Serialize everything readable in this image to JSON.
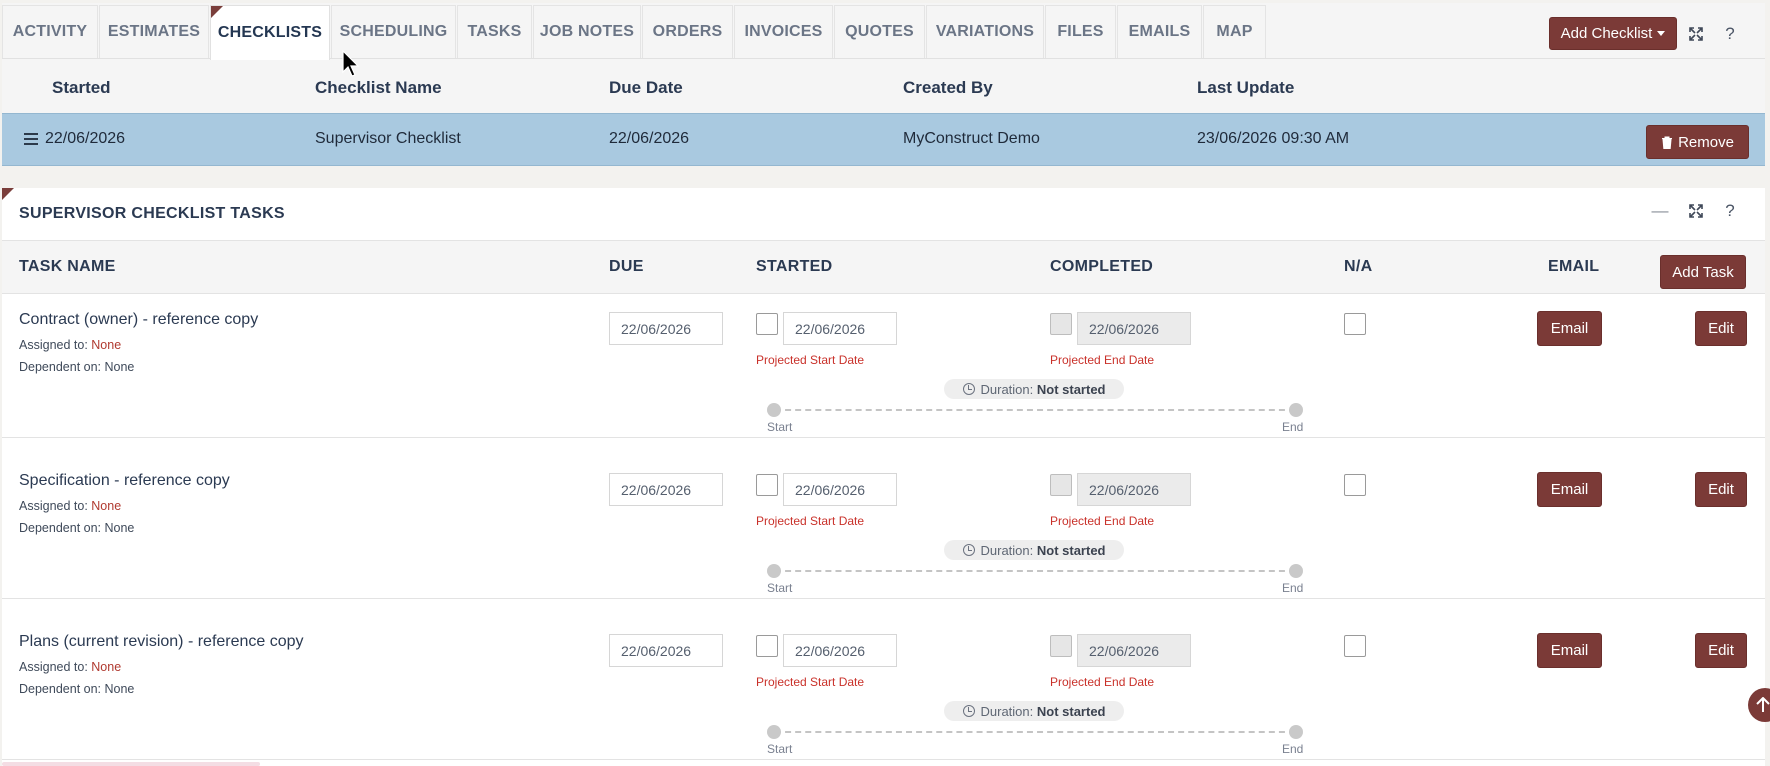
{
  "tabs": [
    {
      "label": "ACTIVITY",
      "active": false
    },
    {
      "label": "ESTIMATES",
      "active": false
    },
    {
      "label": "CHECKLISTS",
      "active": true
    },
    {
      "label": "SCHEDULING",
      "active": false
    },
    {
      "label": "TASKS",
      "active": false
    },
    {
      "label": "JOB NOTES",
      "active": false
    },
    {
      "label": "ORDERS",
      "active": false
    },
    {
      "label": "INVOICES",
      "active": false
    },
    {
      "label": "QUOTES",
      "active": false
    },
    {
      "label": "VARIATIONS",
      "active": false
    },
    {
      "label": "FILES",
      "active": false
    },
    {
      "label": "EMAILS",
      "active": false
    },
    {
      "label": "MAP",
      "active": false
    }
  ],
  "toolbar": {
    "add_checklist_label": "Add Checklist",
    "expand_icon": "expand-icon",
    "help_label": "?"
  },
  "checklists_table": {
    "headers": [
      "Started",
      "Checklist Name",
      "Due Date",
      "Created By",
      "Last Update"
    ],
    "rows": [
      {
        "started": "22/06/2026",
        "name": "Supervisor Checklist",
        "due": "22/06/2026",
        "created_by": "MyConstruct Demo",
        "last_update": "23/06/2026 09:30 AM",
        "remove_label": "Remove"
      }
    ]
  },
  "tasks_panel": {
    "title": "SUPERVISOR CHECKLIST TASKS",
    "minimize_label": "—",
    "help_label": "?",
    "headers": {
      "task_name": "TASK NAME",
      "due": "DUE",
      "started": "STARTED",
      "completed": "COMPLETED",
      "na": "N/A",
      "email": "EMAIL"
    },
    "add_task_label": "Add Task",
    "assigned_prefix": "Assigned to:",
    "dependent_prefix": "Dependent on:",
    "projected_start_label": "Projected Start Date",
    "projected_end_label": "Projected End Date",
    "duration_prefix": "Duration:",
    "start_label": "Start",
    "end_label": "End",
    "email_label": "Email",
    "edit_label": "Edit",
    "tasks": [
      {
        "name": "Contract (owner) - reference copy",
        "assigned_to": "None",
        "dependent_on": "None",
        "due": "22/06/2026",
        "started_date": "22/06/2026",
        "completed_date": "22/06/2026",
        "duration": "Not started"
      },
      {
        "name": "Specification - reference copy",
        "assigned_to": "None",
        "dependent_on": "None",
        "due": "22/06/2026",
        "started_date": "22/06/2026",
        "completed_date": "22/06/2026",
        "duration": "Not started"
      },
      {
        "name": "Plans (current revision) - reference copy",
        "assigned_to": "None",
        "dependent_on": "None",
        "due": "22/06/2026",
        "started_date": "22/06/2026",
        "completed_date": "22/06/2026",
        "duration": "Not started"
      }
    ]
  },
  "colors": {
    "accent": "#7b3a37",
    "selected_row": "#a9c9e0",
    "warning_text": "#c9312a"
  }
}
